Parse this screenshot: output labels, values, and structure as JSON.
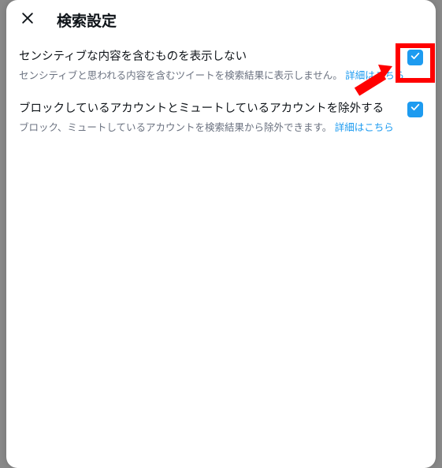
{
  "header": {
    "title": "検索設定"
  },
  "options": [
    {
      "title": "センシティブな内容を含むものを表示しない",
      "desc_prefix": "センシティブと思われる内容を含むツイートを検索結果に表示しません。",
      "link": "詳細はこちら",
      "checked": true
    },
    {
      "title": "ブロックしているアカウントとミュートしているアカウントを除外する",
      "desc_prefix": "ブロック、ミュートしているアカウントを検索結果から除外できます。",
      "link": "詳細はこちら",
      "checked": true
    }
  ],
  "annotation": {
    "highlight": "first-checkbox",
    "arrow": true
  }
}
